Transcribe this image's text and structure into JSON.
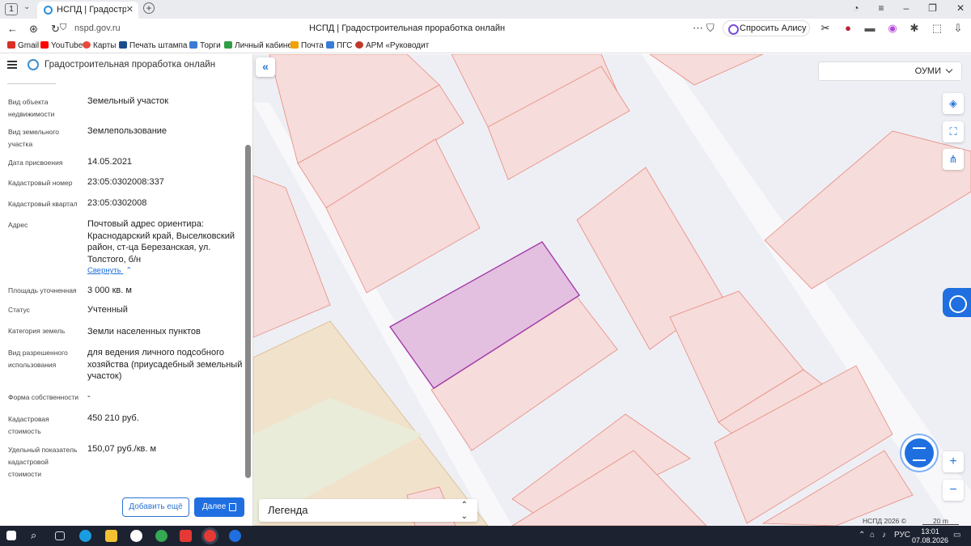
{
  "browser": {
    "tab_count": "1",
    "tab_title": "НСПД | Градостроительная",
    "url": "nspd.gov.ru",
    "page_title": "НСПД | Градостроительная проработка онлайн",
    "alice_label": "Спросить Алису AI",
    "bookmarks": [
      {
        "label": "Gmail",
        "color": "#d93025"
      },
      {
        "label": "YouTube",
        "color": "#ff0000"
      },
      {
        "label": "Карты",
        "color": "#e84a3c"
      },
      {
        "label": "Печать штампа о",
        "color": "#1b4d8c"
      },
      {
        "label": "Торги",
        "color": "#3a7bd5"
      },
      {
        "label": "Личный кабинет",
        "color": "#2f9e44"
      },
      {
        "label": "Почта",
        "color": "#f2a100"
      },
      {
        "label": "ПГС",
        "color": "#3a7bd5"
      },
      {
        "label": "АРМ «Руководит",
        "color": "#c0392b"
      }
    ]
  },
  "app": {
    "title": "Градостроительная проработка онлайн"
  },
  "properties": [
    {
      "label": "Вид объекта недвижимости",
      "value": "Земельный участок"
    },
    {
      "label": "Вид земельного участка",
      "value": "Землепользование"
    },
    {
      "label": "Дата присвоения",
      "value": "14.05.2021"
    },
    {
      "label": "Кадастровый номер",
      "value": "23:05:0302008:337"
    },
    {
      "label": "Кадастровый квартал",
      "value": "23:05:0302008"
    },
    {
      "label": "Адрес",
      "value": "Почтовый адрес ориентира: Краснодарский край, Выселковский район, ст-ца Березанская, ул. Толстого, б/н"
    },
    {
      "label": "Площадь уточненная",
      "value": "3 000 кв. м"
    },
    {
      "label": "Статус",
      "value": "Учтенный"
    },
    {
      "label": "Категория земель",
      "value": "Земли населенных пунктов"
    },
    {
      "label": "Вид разрешенного использования",
      "value": "для ведения личного подсобного хозяйства (приусадебный земельный участок)"
    },
    {
      "label": "Форма собственности",
      "value": "-"
    },
    {
      "label": "Кадастровая стоимость",
      "value": "450 210 руб."
    },
    {
      "label": "Удельный показатель кадастровой стоимости",
      "value": "150,07 руб./кв. м"
    }
  ],
  "collapse_link": "Свернуть",
  "buttons": {
    "add_more": "Добавить ещё",
    "next": "Далее"
  },
  "map": {
    "layer_select": "ОУМИ",
    "legend": "Легенда",
    "copyright": "НСПД 2026 ©",
    "scale": "20 m",
    "colors": {
      "parcel_fill": "#f6dcda",
      "parcel_stroke": "#e88a7f",
      "selected_fill": "#e3bfe0",
      "selected_stroke": "#a33aa8",
      "zone_fill": "#f1e2cc"
    }
  },
  "taskbar": {
    "language": "РУС",
    "time": "13:01",
    "date": "07.08.2026"
  }
}
